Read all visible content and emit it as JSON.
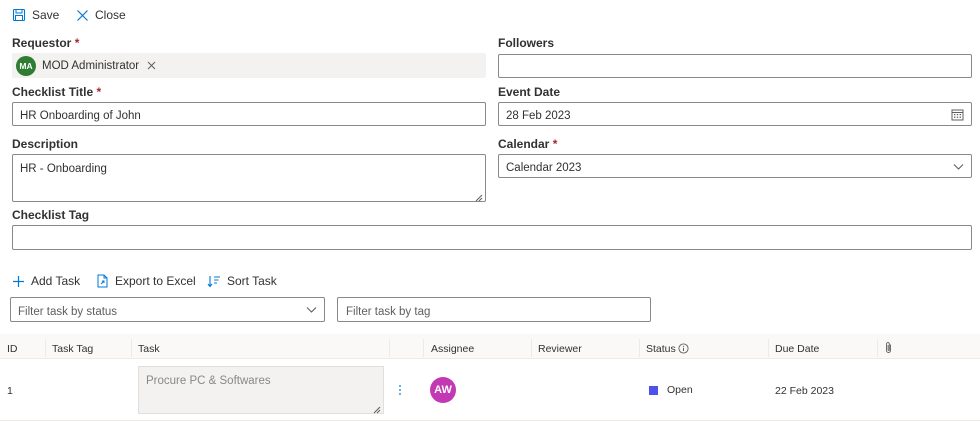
{
  "toolbar": {
    "save_label": "Save",
    "close_label": "Close"
  },
  "form": {
    "requestor": {
      "label": "Requestor",
      "required_mark": "*",
      "person_initials": "MA",
      "person_name": "MOD Administrator",
      "person_color": "#2e7d32"
    },
    "followers": {
      "label": "Followers",
      "value": ""
    },
    "checklist_title": {
      "label": "Checklist Title",
      "required_mark": "*",
      "value": "HR Onboarding of John"
    },
    "event_date": {
      "label": "Event Date",
      "value": "28 Feb 2023",
      "icon": "calendar-icon"
    },
    "description": {
      "label": "Description",
      "value": "HR - Onboarding"
    },
    "calendar": {
      "label": "Calendar",
      "required_mark": "*",
      "value": "Calendar 2023"
    },
    "checklist_tag": {
      "label": "Checklist Tag",
      "value": ""
    }
  },
  "task_toolbar": {
    "add_task_label": "Add Task",
    "export_label": "Export to Excel",
    "sort_label": "Sort Task"
  },
  "filters": {
    "status_placeholder": "Filter task by status",
    "tag_placeholder": "Filter task by tag"
  },
  "table": {
    "headers": {
      "id": "ID",
      "task_tag": "Task Tag",
      "task": "Task",
      "assignee": "Assignee",
      "reviewer": "Reviewer",
      "status": "Status",
      "due_date": "Due Date"
    },
    "rows": [
      {
        "id": "1",
        "task_tag": "",
        "task": "Procure PC & Softwares",
        "assignee_initials": "AW",
        "assignee_color": "#c239b3",
        "reviewer": "",
        "status": "Open",
        "status_color": "#4f52e8",
        "due_date": "22 Feb 2023"
      }
    ]
  }
}
